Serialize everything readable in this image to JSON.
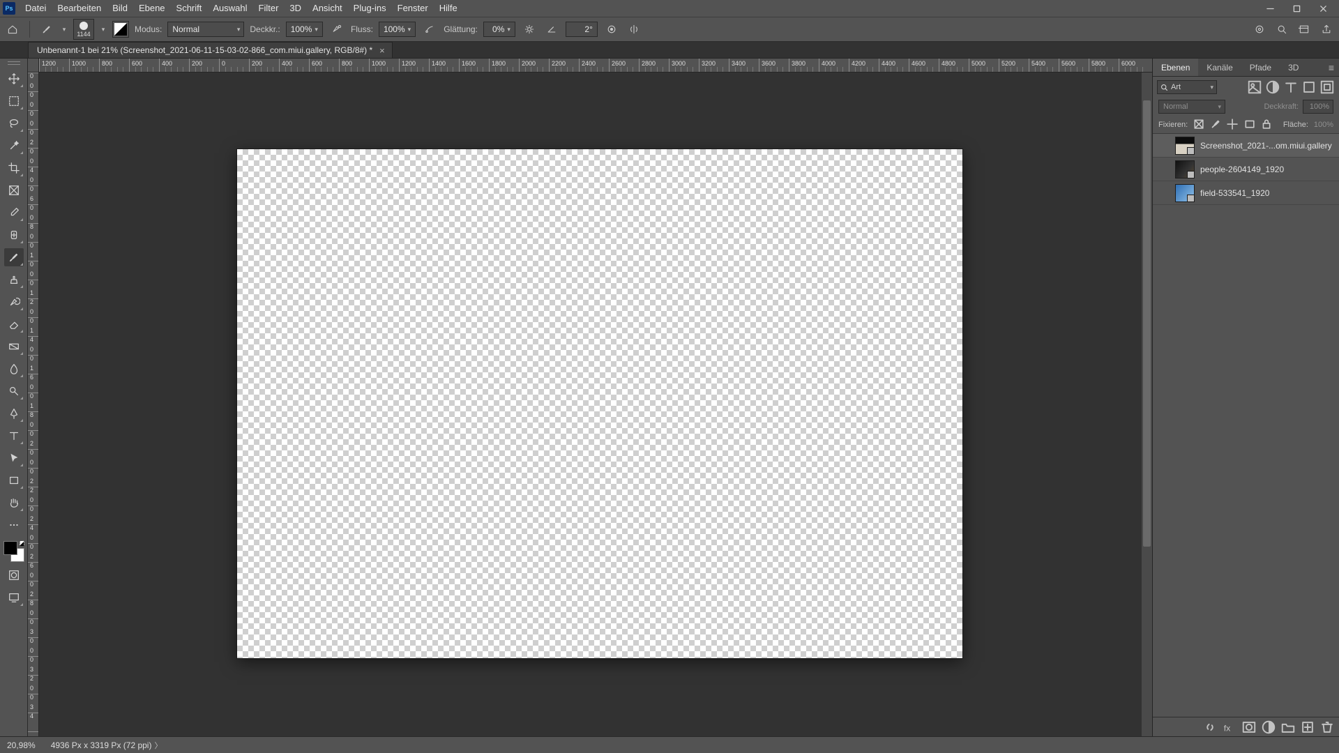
{
  "app_initials": "Ps",
  "menu": [
    "Datei",
    "Bearbeiten",
    "Bild",
    "Ebene",
    "Schrift",
    "Auswahl",
    "Filter",
    "3D",
    "Ansicht",
    "Plug-ins",
    "Fenster",
    "Hilfe"
  ],
  "brush_size": "1144",
  "opt": {
    "mode_label": "Modus:",
    "mode_value": "Normal",
    "opacity_label": "Deckkr.:",
    "opacity_value": "100%",
    "flow_label": "Fluss:",
    "flow_value": "100%",
    "smooth_label": "Glättung:",
    "smooth_value": "0%",
    "angle_value": "2°"
  },
  "doc_tab": "Unbenannt-1 bei 21% (Screenshot_2021-06-11-15-03-02-866_com.miui.gallery, RGB/8#) *",
  "ruler_h": [
    "1200",
    "1000",
    "800",
    "600",
    "400",
    "200",
    "0",
    "200",
    "400",
    "600",
    "800",
    "1000",
    "1200",
    "1400",
    "1600",
    "1800",
    "2000",
    "2200",
    "2400",
    "2600",
    "2800",
    "3000",
    "3200",
    "3400",
    "3600",
    "3800",
    "4000",
    "4200",
    "4400",
    "4600",
    "4800",
    "5000",
    "5200",
    "5400",
    "5600",
    "5800",
    "6000"
  ],
  "ruler_v": [
    "0",
    "0",
    "0",
    "0",
    "0",
    "0",
    "0",
    "2",
    "0",
    "0",
    "4",
    "0",
    "0",
    "6",
    "0",
    "0",
    "8",
    "0",
    "0",
    "1",
    "0",
    "0",
    "0",
    "1",
    "2",
    "0",
    "0",
    "1",
    "4",
    "0",
    "0",
    "1",
    "6",
    "0",
    "0",
    "1",
    "8",
    "0",
    "0",
    "2",
    "0",
    "0",
    "0",
    "2",
    "2",
    "0",
    "0",
    "2",
    "4",
    "0",
    "0",
    "2",
    "6",
    "0",
    "0",
    "2",
    "8",
    "0",
    "0",
    "3",
    "0",
    "0",
    "0",
    "3",
    "2",
    "0",
    "0",
    "3",
    "4"
  ],
  "panel": {
    "tabs": [
      "Ebenen",
      "Kanäle",
      "Pfade",
      "3D"
    ],
    "search": "Art",
    "blend": "Normal",
    "opacity_label": "Deckkraft:",
    "opacity_value": "100%",
    "lock_label": "Fixieren:",
    "fill_label": "Fläche:",
    "fill_value": "100%"
  },
  "layers": [
    {
      "name": "Screenshot_2021-...om.miui.gallery",
      "thumb": "screenshot",
      "selected": true
    },
    {
      "name": "people-2604149_1920",
      "thumb": "dark",
      "selected": false
    },
    {
      "name": "field-533541_1920",
      "thumb": "blue",
      "selected": false
    }
  ],
  "status": {
    "zoom": "20,98%",
    "dims": "4936 Px x 3319 Px (72 ppi)"
  }
}
